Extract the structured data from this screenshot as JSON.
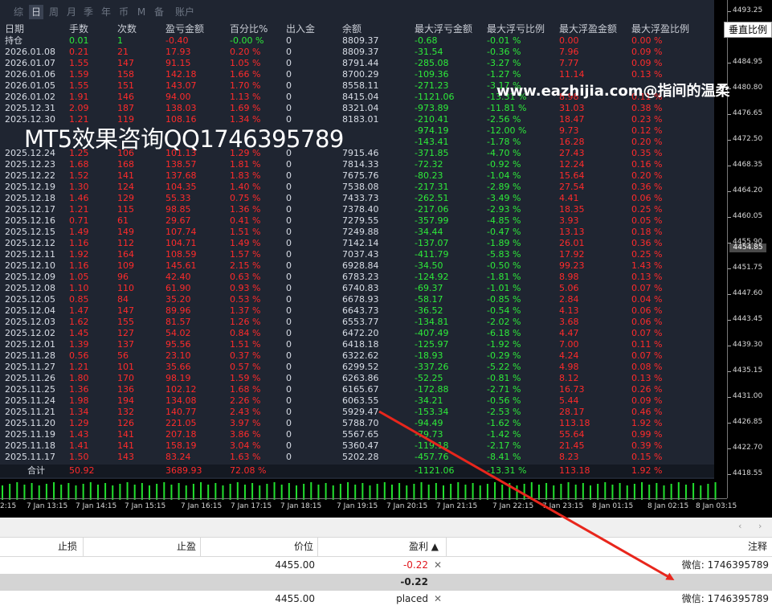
{
  "period_tabs": [
    "综",
    "日",
    "周",
    "月",
    "季",
    "年",
    "币",
    "M",
    "备",
    "账户"
  ],
  "active_tab": 1,
  "columns": [
    "日期",
    "手数",
    "次数",
    "盈亏金额",
    "百分比%",
    "出入金",
    "余额",
    "最大浮亏金额",
    "最大浮亏比例",
    "最大浮盈金额",
    "最大浮盈比例"
  ],
  "position_row": [
    "持仓",
    "0.01",
    "1",
    "-0.40",
    "-0.00 %",
    "0",
    "8809.37",
    "-0.68",
    "-0.01 %",
    "0.00",
    "0.00 %"
  ],
  "rows": [
    [
      "2026.01.08",
      "0.21",
      "21",
      "17.93",
      "0.20 %",
      "0",
      "8809.37",
      "-31.54",
      "-0.36 %",
      "7.96",
      "0.09 %"
    ],
    [
      "2026.01.07",
      "1.55",
      "147",
      "91.15",
      "1.05 %",
      "0",
      "8791.44",
      "-285.08",
      "-3.27 %",
      "7.77",
      "0.09 %"
    ],
    [
      "2026.01.06",
      "1.59",
      "158",
      "142.18",
      "1.66 %",
      "0",
      "8700.29",
      "-109.36",
      "-1.27 %",
      "11.14",
      "0.13 %"
    ],
    [
      "2026.01.05",
      "1.55",
      "151",
      "143.07",
      "1.70 %",
      "0",
      "8558.11",
      "-271.23",
      "-3.17 %",
      "",
      ""
    ],
    [
      "2026.01.02",
      "1.91",
      "146",
      "94.00",
      "1.13 %",
      "0",
      "8415.04",
      "-1121.06",
      "-13.31 %",
      "8.98",
      "0.11 %"
    ],
    [
      "2025.12.31",
      "2.09",
      "187",
      "138.03",
      "1.69 %",
      "0",
      "8321.04",
      "-973.89",
      "-11.81 %",
      "31.03",
      "0.38 %"
    ],
    [
      "2025.12.30",
      "1.21",
      "119",
      "108.16",
      "1.34 %",
      "0",
      "8183.01",
      "-210.41",
      "-2.56 %",
      "18.47",
      "0.23 %"
    ],
    [
      "",
      "",
      "",
      "",
      "",
      "",
      "",
      "-974.19",
      "-12.00 %",
      "9.73",
      "0.12 %"
    ],
    [
      "",
      "",
      "",
      "",
      "",
      "",
      "",
      "-143.41",
      "-1.78 %",
      "16.28",
      "0.20 %"
    ],
    [
      "2025.12.24",
      "1.25",
      "106",
      "101.13",
      "1.29 %",
      "0",
      "7915.46",
      "-371.85",
      "-4.70 %",
      "27.43",
      "0.35 %"
    ],
    [
      "2025.12.23",
      "1.68",
      "168",
      "138.57",
      "1.81 %",
      "0",
      "7814.33",
      "-72.32",
      "-0.92 %",
      "12.24",
      "0.16 %"
    ],
    [
      "2025.12.22",
      "1.52",
      "141",
      "137.68",
      "1.83 %",
      "0",
      "7675.76",
      "-80.23",
      "-1.04 %",
      "15.64",
      "0.20 %"
    ],
    [
      "2025.12.19",
      "1.30",
      "124",
      "104.35",
      "1.40 %",
      "0",
      "7538.08",
      "-217.31",
      "-2.89 %",
      "27.54",
      "0.36 %"
    ],
    [
      "2025.12.18",
      "1.46",
      "129",
      "55.33",
      "0.75 %",
      "0",
      "7433.73",
      "-262.51",
      "-3.49 %",
      "4.41",
      "0.06 %"
    ],
    [
      "2025.12.17",
      "1.21",
      "115",
      "98.85",
      "1.36 %",
      "0",
      "7378.40",
      "-217.06",
      "-2.93 %",
      "18.35",
      "0.25 %"
    ],
    [
      "2025.12.16",
      "0.71",
      "61",
      "29.67",
      "0.41 %",
      "0",
      "7279.55",
      "-357.99",
      "-4.85 %",
      "3.93",
      "0.05 %"
    ],
    [
      "2025.12.15",
      "1.49",
      "149",
      "107.74",
      "1.51 %",
      "0",
      "7249.88",
      "-34.44",
      "-0.47 %",
      "13.13",
      "0.18 %"
    ],
    [
      "2025.12.12",
      "1.16",
      "112",
      "104.71",
      "1.49 %",
      "0",
      "7142.14",
      "-137.07",
      "-1.89 %",
      "26.01",
      "0.36 %"
    ],
    [
      "2025.12.11",
      "1.92",
      "164",
      "108.59",
      "1.57 %",
      "0",
      "7037.43",
      "-411.79",
      "-5.83 %",
      "17.92",
      "0.25 %"
    ],
    [
      "2025.12.10",
      "1.16",
      "109",
      "145.61",
      "2.15 %",
      "0",
      "6928.84",
      "-34.50",
      "-0.50 %",
      "99.23",
      "1.43 %"
    ],
    [
      "2025.12.09",
      "1.05",
      "96",
      "42.40",
      "0.63 %",
      "0",
      "6783.23",
      "-124.92",
      "-1.81 %",
      "8.98",
      "0.13 %"
    ],
    [
      "2025.12.08",
      "1.10",
      "110",
      "61.90",
      "0.93 %",
      "0",
      "6740.83",
      "-69.37",
      "-1.01 %",
      "5.06",
      "0.07 %"
    ],
    [
      "2025.12.05",
      "0.85",
      "84",
      "35.20",
      "0.53 %",
      "0",
      "6678.93",
      "-58.17",
      "-0.85 %",
      "2.84",
      "0.04 %"
    ],
    [
      "2025.12.04",
      "1.47",
      "147",
      "89.96",
      "1.37 %",
      "0",
      "6643.73",
      "-36.52",
      "-0.54 %",
      "4.13",
      "0.06 %"
    ],
    [
      "2025.12.03",
      "1.62",
      "155",
      "81.57",
      "1.26 %",
      "0",
      "6553.77",
      "-134.81",
      "-2.02 %",
      "3.68",
      "0.06 %"
    ],
    [
      "2025.12.02",
      "1.45",
      "127",
      "54.02",
      "0.84 %",
      "0",
      "6472.20",
      "-407.49",
      "-6.18 %",
      "4.47",
      "0.07 %"
    ],
    [
      "2025.12.01",
      "1.39",
      "137",
      "95.56",
      "1.51 %",
      "0",
      "6418.18",
      "-125.97",
      "-1.92 %",
      "7.00",
      "0.11 %"
    ],
    [
      "2025.11.28",
      "0.56",
      "56",
      "23.10",
      "0.37 %",
      "0",
      "6322.62",
      "-18.93",
      "-0.29 %",
      "4.24",
      "0.07 %"
    ],
    [
      "2025.11.27",
      "1.21",
      "101",
      "35.66",
      "0.57 %",
      "0",
      "6299.52",
      "-337.26",
      "-5.22 %",
      "4.98",
      "0.08 %"
    ],
    [
      "2025.11.26",
      "1.80",
      "170",
      "98.19",
      "1.59 %",
      "0",
      "6263.86",
      "-52.25",
      "-0.81 %",
      "8.12",
      "0.13 %"
    ],
    [
      "2025.11.25",
      "1.36",
      "136",
      "102.12",
      "1.68 %",
      "0",
      "6165.67",
      "-172.88",
      "-2.71 %",
      "16.73",
      "0.26 %"
    ],
    [
      "2025.11.24",
      "1.98",
      "194",
      "134.08",
      "2.26 %",
      "0",
      "6063.55",
      "-34.21",
      "-0.56 %",
      "5.44",
      "0.09 %"
    ],
    [
      "2025.11.21",
      "1.34",
      "132",
      "140.77",
      "2.43 %",
      "0",
      "5929.47",
      "-153.34",
      "-2.53 %",
      "28.17",
      "0.46 %"
    ],
    [
      "2025.11.20",
      "1.29",
      "126",
      "221.05",
      "3.97 %",
      "0",
      "5788.70",
      "-94.49",
      "-1.62 %",
      "113.18",
      "1.92 %"
    ],
    [
      "2025.11.19",
      "1.43",
      "141",
      "207.18",
      "3.86 %",
      "0",
      "5567.65",
      "-79.73",
      "-1.42 %",
      "55.64",
      "0.99 %"
    ],
    [
      "2025.11.18",
      "1.41",
      "141",
      "158.19",
      "3.04 %",
      "0",
      "5360.47",
      "-119.18",
      "-2.17 %",
      "21.45",
      "0.39 %"
    ],
    [
      "2025.11.17",
      "1.50",
      "143",
      "83.24",
      "1.63 %",
      "0",
      "5202.28",
      "-457.76",
      "-8.41 %",
      "8.23",
      "0.15 %"
    ]
  ],
  "totals": [
    "合计",
    "50.92",
    "",
    "3689.93",
    "72.08 %",
    "",
    "",
    "-1121.06",
    "-13.31 %",
    "113.18",
    "1.92 %"
  ],
  "price_axis": [
    "4493.25",
    "4488.90",
    "4484.95",
    "4480.80",
    "4476.65",
    "4472.50",
    "4468.35",
    "4464.20",
    "4460.05",
    "4455.90",
    "4451.75",
    "4447.60",
    "4443.45",
    "4439.30",
    "4435.15",
    "4431.00",
    "4426.85",
    "4422.70",
    "4418.55"
  ],
  "current_price": "4454.85",
  "time_axis": [
    "2:15",
    "7 Jan 13:15",
    "7 Jan 14:15",
    "7 Jan 15:15",
    "7 Jan 16:15",
    "7 Jan 17:15",
    "7 Jan 18:15",
    "7 Jan 19:15",
    "7 Jan 20:15",
    "7 Jan 21:15",
    "7 Jan 22:15",
    "7 Jan 23:15",
    "8 Jan 01:15",
    "8 Jan 02:15",
    "8 Jan 03:15"
  ],
  "vscale_button": "垂直比例",
  "watermark_url": "www.eazhijia.com@指间的温柔",
  "watermark_qq": "MT5效果咨询QQ1746395789",
  "trade_columns": {
    "sl": "止损",
    "tp": "止盈",
    "price": "价位",
    "profit": "盈利 ▲",
    "comment": "注释"
  },
  "trade_rows": [
    {
      "price": "4455.00",
      "profit": "-0.22",
      "comment": "微信: 1746395789"
    },
    {
      "price": "4455.00",
      "profit": "placed",
      "comment": "微信: 1746395789"
    }
  ],
  "trade_total": "-0.22",
  "nav_icons": [
    "chevron-left-icon",
    "chevron-right-icon"
  ],
  "colors": {
    "panel": "#1f2531",
    "negative": "#ff2b2b",
    "positive": "#2eea3a",
    "arrow": "#e8261c"
  }
}
